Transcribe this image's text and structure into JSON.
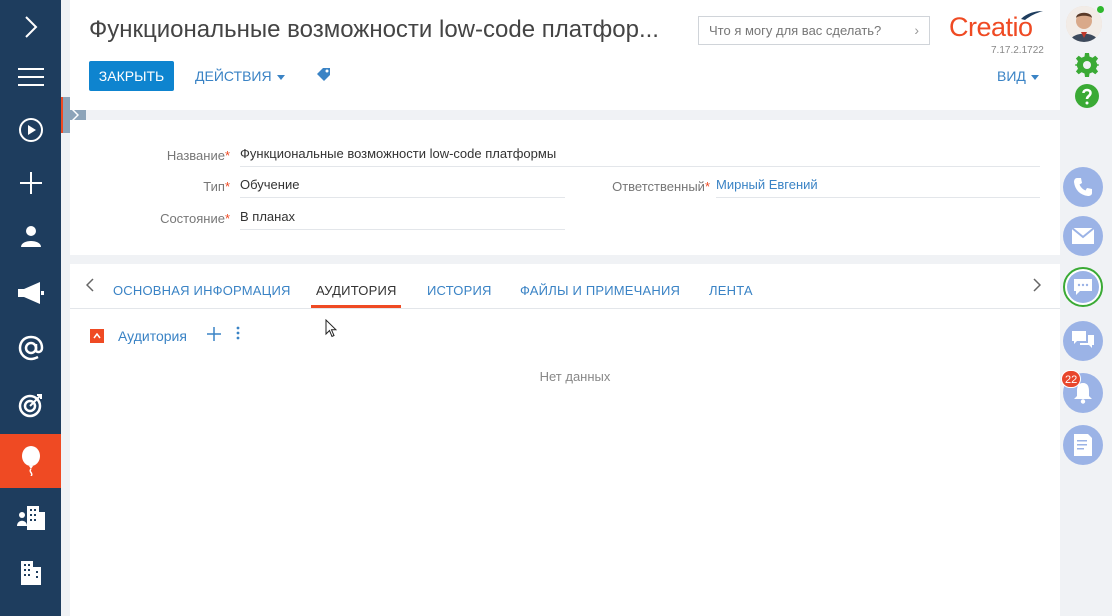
{
  "header": {
    "title": "Функциональные возможности low-code платфор...",
    "search_placeholder": "Что я могу для вас сделать?",
    "logo": "Creatio",
    "version": "7.17.2.1722",
    "close_label": "ЗАКРЫТЬ",
    "actions_label": "ДЕЙСТВИЯ",
    "view_label": "ВИД"
  },
  "fields": {
    "name": {
      "label": "Название",
      "value": "Функциональные возможности low-code платформы"
    },
    "type": {
      "label": "Тип",
      "value": "Обучение"
    },
    "owner": {
      "label": "Ответственный",
      "value": "Мирный Евгений"
    },
    "state": {
      "label": "Состояние",
      "value": "В планах"
    },
    "required_mark": "*"
  },
  "tabs": [
    {
      "label": "ОСНОВНАЯ ИНФОРМАЦИЯ",
      "active": false
    },
    {
      "label": "АУДИТОРИЯ",
      "active": true
    },
    {
      "label": "ИСТОРИЯ",
      "active": false
    },
    {
      "label": "ФАЙЛЫ И ПРИМЕЧАНИЯ",
      "active": false
    },
    {
      "label": "ЛЕНТА",
      "active": false
    }
  ],
  "detail": {
    "title": "Аудитория",
    "empty_text": "Нет данных"
  },
  "leftnav": [
    {
      "icon": "chevron-right-icon"
    },
    {
      "icon": "menu-icon"
    },
    {
      "icon": "play-icon"
    },
    {
      "icon": "plus-icon"
    },
    {
      "icon": "user-icon"
    },
    {
      "icon": "megaphone-icon"
    },
    {
      "icon": "at-icon"
    },
    {
      "icon": "target-icon"
    },
    {
      "icon": "balloon-icon",
      "active": true
    },
    {
      "icon": "buildings-people-icon"
    },
    {
      "icon": "building-icon"
    }
  ],
  "rightbar": {
    "notifications_count": "22",
    "items": [
      "phone-icon",
      "mail-icon",
      "chat-icon",
      "messages-icon",
      "bell-icon",
      "document-icon"
    ]
  },
  "colors": {
    "nav_bg": "#1e3d5e",
    "accent": "#ef4a23",
    "primary_button": "#0e84cf",
    "link": "#3a83c5"
  }
}
